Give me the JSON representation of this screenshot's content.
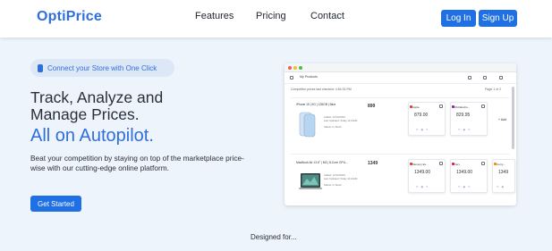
{
  "brand": {
    "name": "OptiPrice",
    "accent": "#2f6fdc",
    "button_color": "#1f6fe5"
  },
  "nav": {
    "features": "Features",
    "pricing": "Pricing",
    "contact": "Contact"
  },
  "auth": {
    "login": "Log In",
    "signup": "Sign Up"
  },
  "hero": {
    "pill": "Connect your Store with One Click",
    "headline_line1": "Track, Analyze and",
    "headline_line2": "Manage Prices.",
    "headline_accent": "All on Autopilot.",
    "description": "Beat your competition by staying on top of the marketplace price-wise with our cutting-edge online platform.",
    "cta": "Get Started"
  },
  "preview": {
    "window_title": "My Products",
    "status": "Competitor prices last checked: 4:54:33 PM",
    "page_indicator": "Page 1 of 2",
    "add_label": "+ Add",
    "products": [
      {
        "title": "iPhone 15 | 5G | 128GB | Blue",
        "price": "899",
        "meta": [
          "Added: 12/12/2023",
          "Last Updated: Today 11:12AM",
          "Status: In Stock"
        ],
        "thumb_icon": "phone-icon",
        "competitors": [
          {
            "name": "Apple",
            "price": "879.00"
          },
          {
            "name": "Old Electro...",
            "price": "829.95"
          }
        ]
      },
      {
        "title": "MacBook Air 13.6\" | M3 | 8-Core GPU...",
        "price": "1349",
        "meta": [
          "Added: 12/12/2023",
          "Last Updated: Today 11:12AM",
          "Status: In Stock"
        ],
        "thumb_icon": "laptop-icon",
        "competitors": [
          {
            "name": "Memory Ex...",
            "price": "1349.00"
          },
          {
            "name": "Very",
            "price": "1349.00"
          },
          {
            "name": "Curry...",
            "price": "1349"
          }
        ]
      }
    ]
  },
  "footer": {
    "designed_for": "Designed for..."
  }
}
